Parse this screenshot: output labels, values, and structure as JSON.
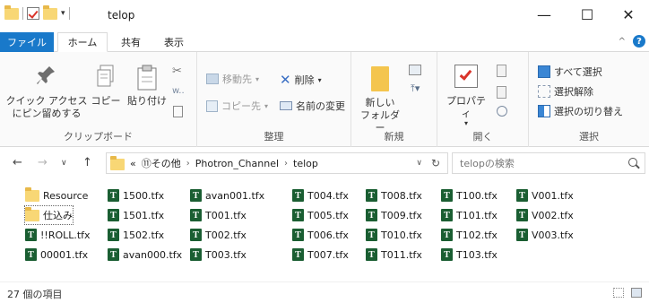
{
  "window": {
    "title": "telop",
    "minimize": "—",
    "maximize": "☐",
    "close": "✕"
  },
  "tabs": {
    "file": "ファイル",
    "home": "ホーム",
    "share": "共有",
    "view": "表示"
  },
  "ribbon": {
    "clipboard": {
      "pin_label_1": "クイック アクセス",
      "pin_label_2": "にピン留めする",
      "copy": "コピー",
      "paste": "貼り付け",
      "group": "クリップボード"
    },
    "organize": {
      "move_to": "移動先",
      "delete": "削除",
      "copy_to": "コピー先",
      "rename": "名前の変更",
      "group": "整理"
    },
    "new": {
      "new_folder_1": "新しい",
      "new_folder_2": "フォルダー",
      "group": "新規"
    },
    "open": {
      "properties": "プロパティ",
      "group": "開く"
    },
    "select": {
      "select_all": "すべて選択",
      "select_none": "選択解除",
      "invert": "選択の切り替え",
      "group": "選択"
    }
  },
  "address": {
    "overflow": "«",
    "crumbs": [
      "⑪その他",
      "Photron_Channel",
      "telop"
    ],
    "search_placeholder": "telopの検索"
  },
  "files": [
    {
      "name": "Resource",
      "type": "folder"
    },
    {
      "name": "仕込み",
      "type": "folder"
    },
    {
      "name": "!!ROLL.tfx",
      "type": "tfx"
    },
    {
      "name": "00001.tfx",
      "type": "tfx"
    },
    {
      "name": "1500.tfx",
      "type": "tfx"
    },
    {
      "name": "1501.tfx",
      "type": "tfx"
    },
    {
      "name": "1502.tfx",
      "type": "tfx"
    },
    {
      "name": "avan000.tfx",
      "type": "tfx"
    },
    {
      "name": "avan001.tfx",
      "type": "tfx"
    },
    {
      "name": "T001.tfx",
      "type": "tfx"
    },
    {
      "name": "T002.tfx",
      "type": "tfx"
    },
    {
      "name": "T003.tfx",
      "type": "tfx"
    },
    {
      "name": "T004.tfx",
      "type": "tfx"
    },
    {
      "name": "T005.tfx",
      "type": "tfx"
    },
    {
      "name": "T006.tfx",
      "type": "tfx"
    },
    {
      "name": "T007.tfx",
      "type": "tfx"
    },
    {
      "name": "T008.tfx",
      "type": "tfx"
    },
    {
      "name": "T009.tfx",
      "type": "tfx"
    },
    {
      "name": "T010.tfx",
      "type": "tfx"
    },
    {
      "name": "T011.tfx",
      "type": "tfx"
    },
    {
      "name": "T100.tfx",
      "type": "tfx"
    },
    {
      "name": "T101.tfx",
      "type": "tfx"
    },
    {
      "name": "T102.tfx",
      "type": "tfx"
    },
    {
      "name": "T103.tfx",
      "type": "tfx"
    },
    {
      "name": "V001.tfx",
      "type": "tfx"
    },
    {
      "name": "V002.tfx",
      "type": "tfx"
    },
    {
      "name": "V003.tfx",
      "type": "tfx"
    }
  ],
  "tfx_letter": "T",
  "status": {
    "count": "27 個の項目"
  },
  "colors": {
    "accent": "#1979ca",
    "tfx_icon": "#1a5e32",
    "folder": "#f8d775"
  }
}
